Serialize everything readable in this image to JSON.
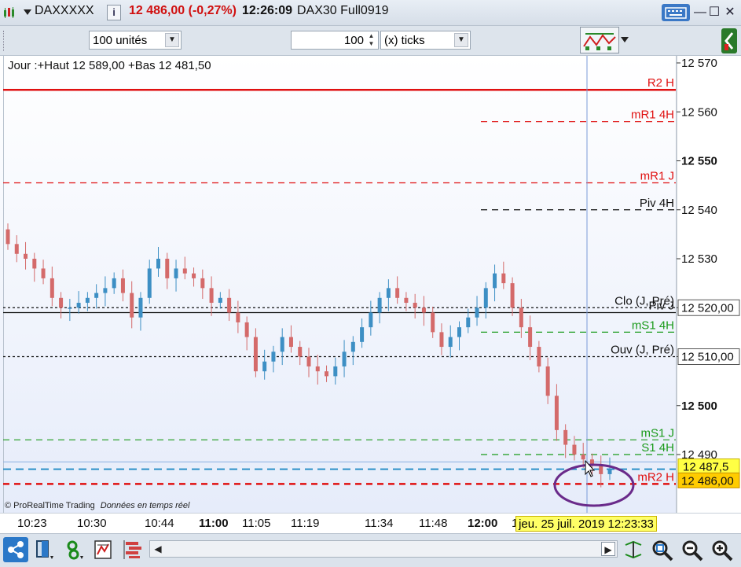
{
  "title_bar": {
    "instrument": "DAXXXXX",
    "info_icon": "info-icon",
    "price_change": "12 486,00 (-0,27%)",
    "time": "12:26:09",
    "contract": "DAX30 Full0919",
    "keyboard_icon": "keyboard-icon"
  },
  "toolbar": {
    "quantity": "100 unités",
    "ticks_value": "100",
    "ticks_unit": "(x) ticks"
  },
  "chart": {
    "info_line": "Jour :+Haut 12 589,00 +Bas 12 481,50",
    "watermark_brand": "© ProRealTime Trading",
    "watermark_note": "Données en temps réel",
    "y_ticks": [
      "12 570",
      "12 560",
      "12 550",
      "12 540",
      "12 530",
      "12 520,00",
      "12 510,00",
      "12 500",
      "12 490"
    ],
    "price_boxes": {
      "current_upper": "12 487,5",
      "current": "12 486,00"
    },
    "levels": [
      {
        "label": "R2 H",
        "value": 12564.5,
        "color": "#e01010",
        "style": "solid"
      },
      {
        "label": "mR1 4H",
        "value": 12558,
        "color": "#e01010",
        "style": "dashed"
      },
      {
        "label": "mR1 J",
        "value": 12545.5,
        "color": "#e01010",
        "style": "dashed"
      },
      {
        "label": "Piv 4H",
        "value": 12540,
        "color": "#111111",
        "style": "dashed"
      },
      {
        "label": "Clo (J, Pré)",
        "value": 12520,
        "color": "#111111",
        "style": "dotted"
      },
      {
        "label": "Piv J",
        "value": 12519,
        "color": "#111111",
        "style": "solid"
      },
      {
        "label": "mS1 4H",
        "value": 12515,
        "color": "#1a9a1a",
        "style": "dashed"
      },
      {
        "label": "Ouv (J, Pré)",
        "value": 12510,
        "color": "#111111",
        "style": "dotted"
      },
      {
        "label": "mS1 J",
        "value": 12493,
        "color": "#1a9a1a",
        "style": "dashed"
      },
      {
        "label": "S1 4H",
        "value": 12490,
        "color": "#1a9a1a",
        "style": "dashed"
      },
      {
        "label": "mR2 H",
        "value": 12484,
        "color": "#e01010",
        "style": "dashed"
      }
    ],
    "x_ticks": [
      "10:23",
      "10:30",
      "10:44",
      "11:00",
      "11:05",
      "11:19",
      "11:34",
      "11:48",
      "12:00",
      "1"
    ],
    "cursor_label": "jeu. 25 juil. 2019 12:23:33",
    "colors": {
      "up": "#3d8fc4",
      "down": "#d46a6a",
      "background": "#f3f6fd",
      "annotation_circle": "#6a2a8a"
    }
  },
  "chart_data": {
    "type": "candlestick",
    "title": "Jour :+Haut 12 589,00 +Bas 12 481,50",
    "ylim": [
      12476,
      12574
    ],
    "x_ticks": [
      "10:23",
      "10:30",
      "10:44",
      "11:00",
      "11:05",
      "11:19",
      "11:34",
      "11:48",
      "12:00"
    ],
    "closes": [
      12533,
      12531,
      12530,
      12528,
      12526,
      12522,
      12520,
      12520,
      12521,
      12522,
      12523,
      12524,
      12526,
      12523,
      12518,
      12522,
      12528,
      12530,
      12526,
      12528,
      12527,
      12526,
      12524,
      12521,
      12522,
      12519,
      12517,
      12514,
      12507,
      12509,
      12511,
      12514,
      12512,
      12510,
      12508,
      12507,
      12506,
      12508,
      12511,
      12513,
      12516,
      12519,
      12522,
      12524,
      12522,
      12521,
      12520,
      12519,
      12515,
      12512,
      12514,
      12516,
      12518,
      12520,
      12524,
      12527,
      12525,
      12520,
      12516,
      12512,
      12508,
      12502,
      12495,
      12492,
      12490,
      12489,
      12488,
      12486,
      12487
    ]
  },
  "bottom_bar": {
    "icons": [
      "share-icon",
      "layout-icon",
      "indicator-icon",
      "drawing-icon",
      "list-icon"
    ],
    "zoom_icons": [
      "zoom-reset-icon",
      "zoom-out-icon",
      "zoom-in-icon"
    ]
  }
}
